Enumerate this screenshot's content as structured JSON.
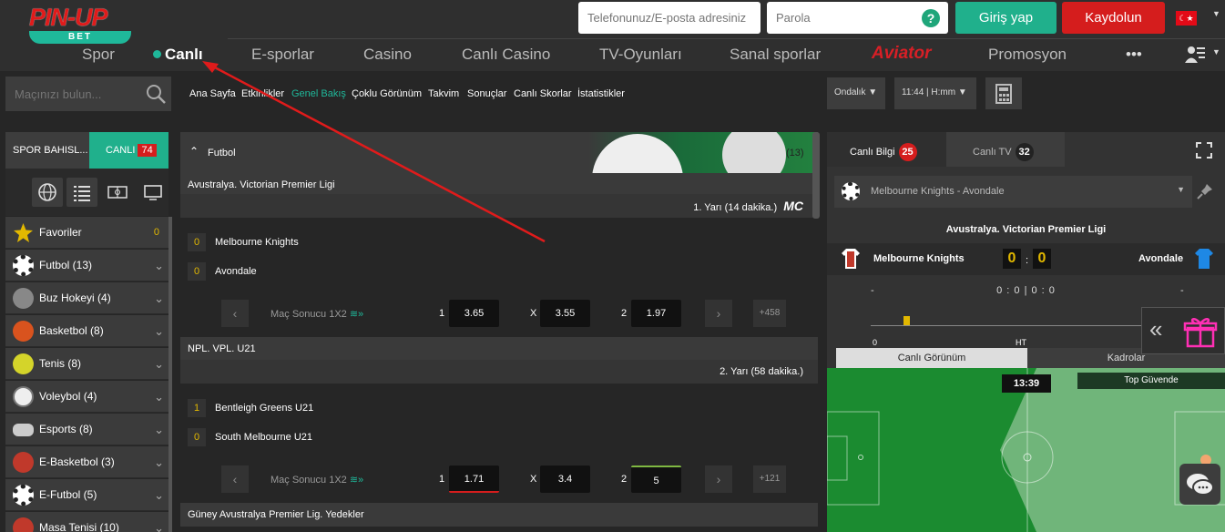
{
  "header": {
    "logo_top": "PIN-UP",
    "logo_bottom": "BET",
    "phone_placeholder": "Telefonunuz/E-posta adresiniz",
    "password_placeholder": "Parola",
    "help": "?",
    "login": "Giriş yap",
    "register": "Kaydolun",
    "nav": [
      "Spor",
      "Canlı",
      "E-sporlar",
      "Casino",
      "Canlı Casino",
      "TV-Oyunları",
      "Sanal sporlar",
      "Aviator",
      "Promosyon"
    ],
    "more": "•••"
  },
  "subbar": {
    "search_placeholder": "Maçınızı bulun...",
    "links": [
      "Ana Sayfa",
      "Etkinlikler",
      "Genel Bakış",
      "Çoklu Görünüm",
      "Takvim",
      "Sonuçlar",
      "Canlı Skorlar",
      "İstatistikler"
    ],
    "odds_format": "Ondalık",
    "time_format": "11:44 | H:mm"
  },
  "sidebar": {
    "tab_sports": "SPOR BAHISL...",
    "tab_live": "CANLI",
    "live_count": "74",
    "sports": [
      {
        "label": "Favoriler",
        "count": "0"
      },
      {
        "label": "Futbol (13)"
      },
      {
        "label": "Buz Hokeyi (4)"
      },
      {
        "label": "Basketbol (8)"
      },
      {
        "label": "Tenis (8)"
      },
      {
        "label": "Voleybol (4)"
      },
      {
        "label": "Esports (8)"
      },
      {
        "label": "E-Basketbol (3)"
      },
      {
        "label": "E-Futbol (5)"
      },
      {
        "label": "Masa Tenisi (10)"
      }
    ]
  },
  "center": {
    "section_title": "Futbol",
    "section_count": "(13)",
    "matches": [
      {
        "league": "Avustralya. Victorian Premier Ligi",
        "period": "1. Yarı",
        "minute": "(14 dakika.)",
        "badge": "MC",
        "home": "Melbourne Knights",
        "home_score": "0",
        "away": "Avondale",
        "away_score": "0",
        "market": "Maç Sonucu 1X2",
        "o1_label": "1",
        "o1": "3.65",
        "ox_label": "X",
        "ox": "3.55",
        "o2_label": "2",
        "o2": "1.97",
        "more": "+458"
      },
      {
        "league": "NPL. VPL. U21",
        "period": "2. Yarı",
        "minute": "(58 dakika.)",
        "home": "Bentleigh Greens U21",
        "home_score": "1",
        "away": "South Melbourne U21",
        "away_score": "0",
        "market": "Maç Sonucu 1X2",
        "o1_label": "1",
        "o1": "1.71",
        "ox_label": "X",
        "ox": "3.4",
        "o2_label": "2",
        "o2": "5",
        "more": "+121"
      }
    ],
    "next_league": "Güney Avustralya Premier Lig. Yedekler"
  },
  "right": {
    "tab_info": "Canlı Bilgi",
    "info_count": "25",
    "tab_tv": "Canlı TV",
    "tv_count": "32",
    "match_select": "Melbourne Knights - Avondale",
    "league": "Avustralya. Victorian Premier Ligi",
    "home": "Melbourne Knights",
    "away": "Avondale",
    "home_score": "0",
    "away_score": "0",
    "score_sep": ":",
    "dash_left": "-",
    "dash_right": "-",
    "stats": "0 : 0 | 0 : 0",
    "tl_start": "0",
    "tl_ht": "HT",
    "subtab1": "Canlı Görünüm",
    "subtab2": "Kadrolar",
    "clock": "13:39",
    "status": "Top Güvende"
  }
}
